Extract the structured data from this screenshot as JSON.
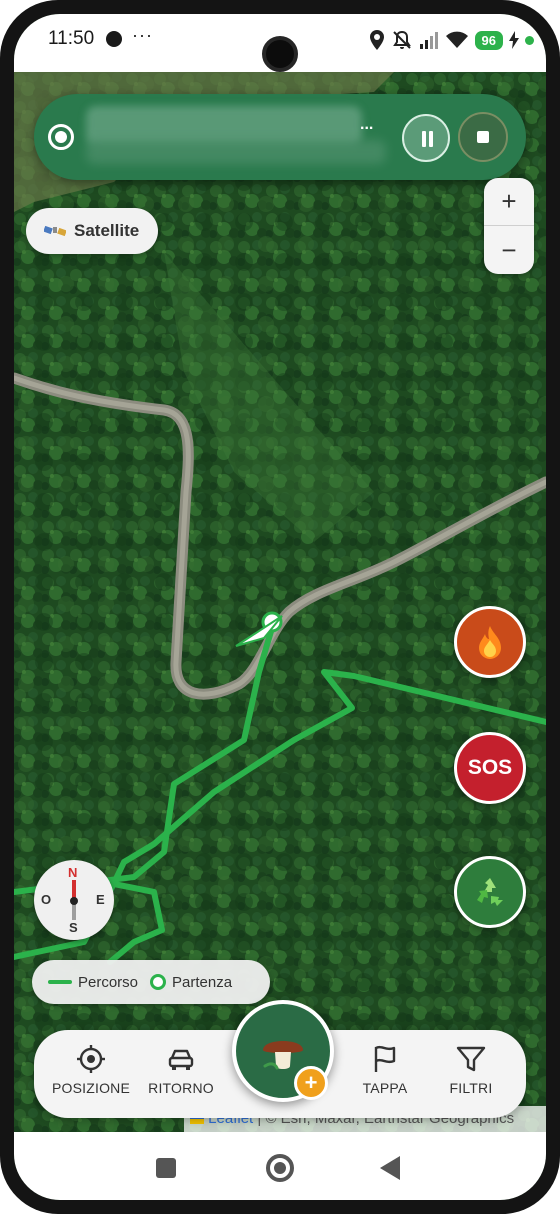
{
  "status_bar": {
    "time": "11:50",
    "more": "···",
    "battery": "96",
    "icons": [
      "media-dot-icon",
      "location-pin-icon",
      "mute-icon",
      "signal-icon",
      "wifi-icon",
      "charging-icon"
    ]
  },
  "tracking_banner": {
    "status_icon": "recording-icon",
    "ellipsis": "...",
    "pause_icon": "pause-icon",
    "stop_icon": "stop-icon"
  },
  "map_controls": {
    "layer_label": "Satellite",
    "zoom_in": "+",
    "zoom_out": "−"
  },
  "action_buttons": {
    "fire_icon": "fire-icon",
    "sos_label": "SOS",
    "recycle_icon": "recycle-icon"
  },
  "compass": {
    "north": "N",
    "south": "S",
    "west": "O",
    "east": "E"
  },
  "legend": {
    "route_label": "Percorso",
    "start_label": "Partenza"
  },
  "bottom_bar": {
    "items": [
      {
        "label": "POSIZIONE",
        "icon": "crosshair-icon"
      },
      {
        "label": "RITORNO",
        "icon": "car-icon"
      },
      {
        "label": "TAPPA",
        "icon": "flag-icon"
      },
      {
        "label": "FILTRI",
        "icon": "filter-icon"
      }
    ],
    "fab_icon": "mushroom-icon",
    "fab_plus": "+"
  },
  "attribution": {
    "leaflet": "Leaflet",
    "credits": " | © Esri, Maxar, Earthstar Geographics"
  },
  "colors": {
    "accent": "#2a7a4d",
    "route": "#2bb24b",
    "sos": "#c4202d",
    "fire": "#c94b1a",
    "plus": "#f0a01c"
  }
}
